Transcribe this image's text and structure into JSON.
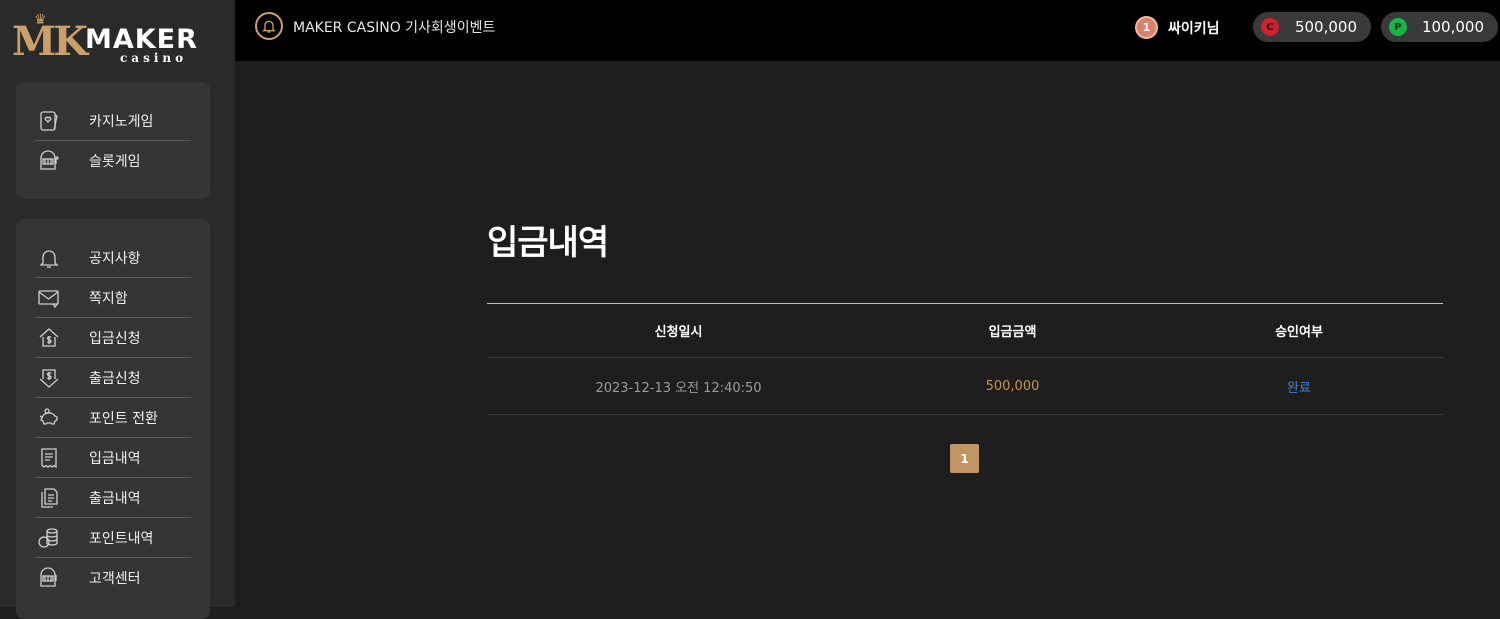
{
  "brand": {
    "logo_mark": "MK",
    "logo_word": "MAKER",
    "logo_sub": "casino"
  },
  "sidebar": {
    "top_items": [
      {
        "label": "카지노게임",
        "icon": "casino-card-icon"
      },
      {
        "label": "슬롯게임",
        "icon": "slot-machine-icon"
      }
    ],
    "bottom_items": [
      {
        "label": "공지사항",
        "icon": "bell-icon"
      },
      {
        "label": "쪽지함",
        "icon": "mail-icon"
      },
      {
        "label": "입금신청",
        "icon": "deposit-icon"
      },
      {
        "label": "출금신청",
        "icon": "withdraw-icon"
      },
      {
        "label": "포인트 전환",
        "icon": "piggy-bank-icon"
      },
      {
        "label": "입금내역",
        "icon": "receipt-icon"
      },
      {
        "label": "출금내역",
        "icon": "documents-icon"
      },
      {
        "label": "포인트내역",
        "icon": "coins-icon"
      },
      {
        "label": "고객센터",
        "icon": "support-icon"
      }
    ]
  },
  "header": {
    "notice": "MAKER CASINO 기사회생이벤트",
    "badge_count": "1",
    "username": "싸이키님",
    "cash_symbol": "C",
    "cash": "500,000",
    "point_symbol": "P",
    "points": "100,000",
    "colors": {
      "cash": "#d0202a",
      "point": "#18b44a",
      "accent": "#c9a06a"
    }
  },
  "main": {
    "title": "입금내역",
    "columns": [
      "신청일시",
      "입금금액",
      "승인여부"
    ],
    "rows": [
      {
        "date": "2023-12-13 오전 12:40:50",
        "amount": "500,000",
        "status": "완료"
      }
    ],
    "page": "1"
  }
}
